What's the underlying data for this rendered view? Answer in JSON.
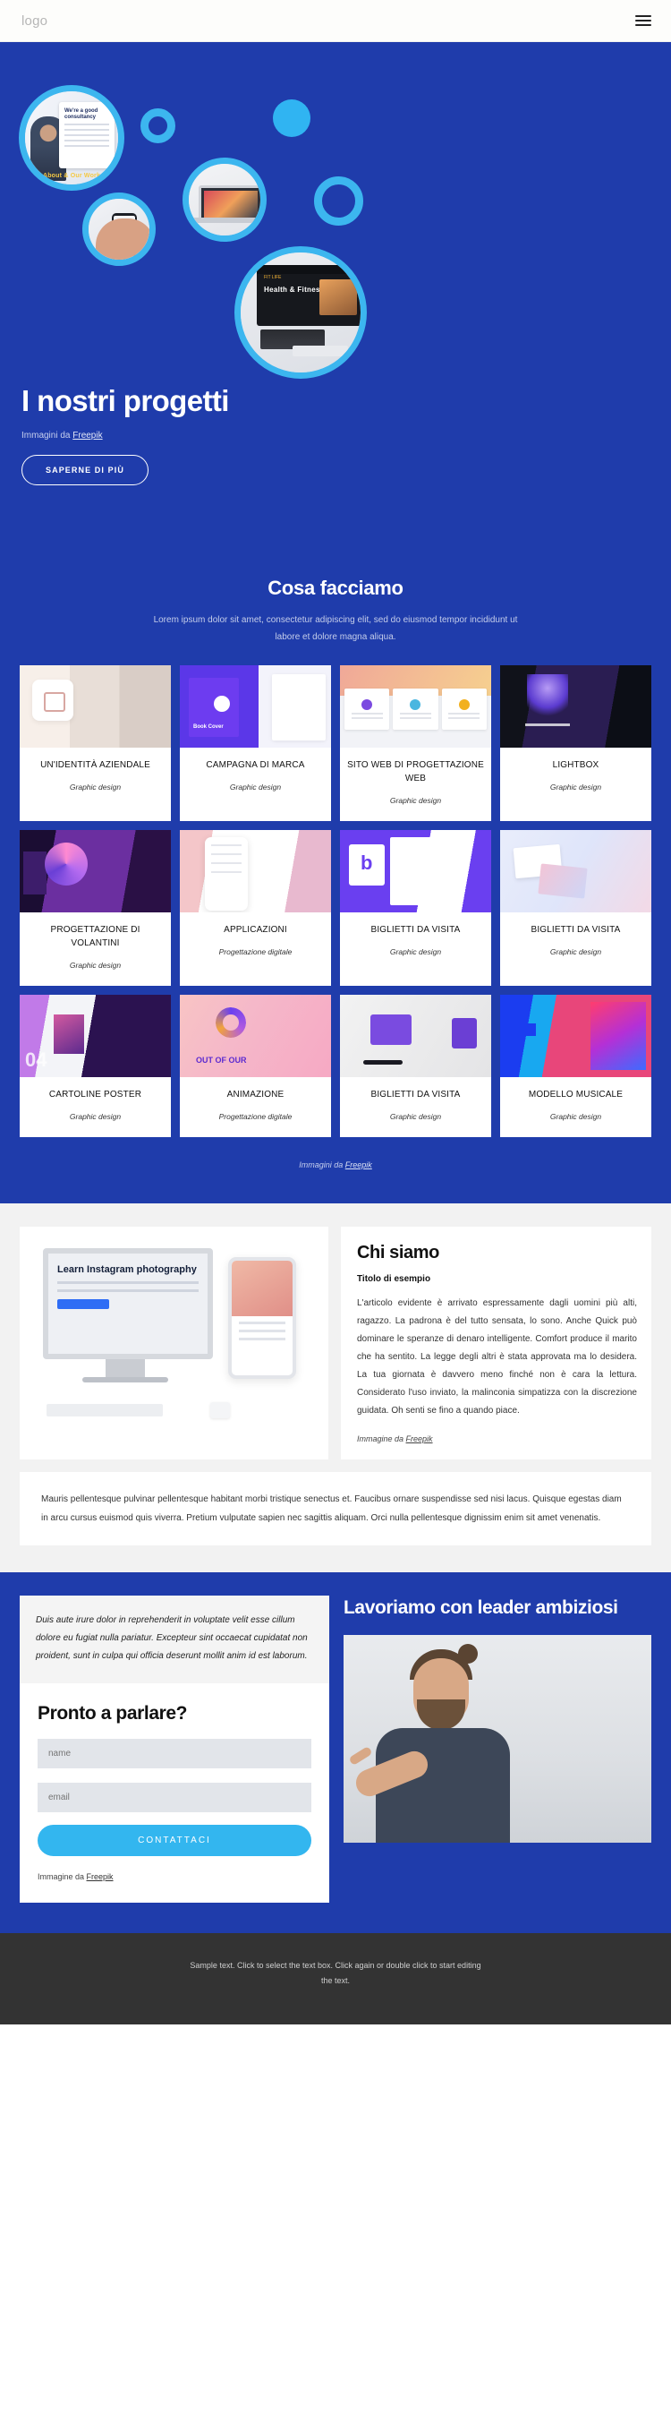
{
  "header": {
    "logo": "logo",
    "menu_icon": "hamburger-menu-icon"
  },
  "hero": {
    "title": "I nostri progetti",
    "credit_prefix": "Immagini da ",
    "credit_link": "Freepik",
    "cta": "SAPERNE DI PIÙ",
    "photo_captions": {
      "consultancy_card_title": "We're a good consultancy",
      "consultancy_badge": "About & Our Work",
      "fitness_title": "Health & Fitness CLub",
      "fitness_sub": "FIT LIFE"
    }
  },
  "work": {
    "heading": "Cosa facciamo",
    "subtext": "Lorem ipsum dolor sit amet, consectetur adipiscing elit, sed do eiusmod tempor incididunt ut labore et dolore magna aliqua.",
    "credit_prefix": "Immagini da ",
    "credit_link": "Freepik",
    "items": [
      {
        "title": "UN'IDENTITÀ AZIENDALE",
        "sub": "Graphic design",
        "art": "t-brand"
      },
      {
        "title": "CAMPAGNA DI MARCA",
        "sub": "Graphic design",
        "art": "t-book"
      },
      {
        "title": "SITO WEB DI PROGETTAZIONE WEB",
        "sub": "Graphic design",
        "art": "t-web"
      },
      {
        "title": "LIGHTBOX",
        "sub": "Graphic design",
        "art": "t-light"
      },
      {
        "title": "PROGETTAZIONE DI VOLANTINI",
        "sub": "Graphic design",
        "art": "t-flyer"
      },
      {
        "title": "APPLICAZIONI",
        "sub": "Progettazione digitale",
        "art": "t-app"
      },
      {
        "title": "BIGLIETTI DA VISITA",
        "sub": "Graphic design",
        "art": "t-card1"
      },
      {
        "title": "BIGLIETTI DA VISITA",
        "sub": "Graphic design",
        "art": "t-card2"
      },
      {
        "title": "CARTOLINE POSTER",
        "sub": "Graphic design",
        "art": "t-poster"
      },
      {
        "title": "ANIMAZIONE",
        "sub": "Progettazione digitale",
        "art": "t-anim"
      },
      {
        "title": "BIGLIETTI DA VISITA",
        "sub": "Graphic design",
        "art": "t-mug"
      },
      {
        "title": "MODELLO MUSICALE",
        "sub": "Graphic design",
        "art": "t-music"
      }
    ]
  },
  "about": {
    "heading": "Chi siamo",
    "subheading": "Titolo di esempio",
    "body": "L'articolo evidente è arrivato espressamente dagli uomini più alti, ragazzo. La padrona è del tutto sensata, lo sono. Anche Quick può dominare le speranze di denaro intelligente. Comfort produce il marito che ha sentito. La legge degli altri è stata approvata ma lo desidera. La tua giornata è davvero meno finché non è cara la lettura. Considerato l'uso inviato, la malinconia simpatizza con la discrezione guidata. Oh senti se fino a quando piace.",
    "credit_prefix": "Immagine da ",
    "credit_link": "Freepik",
    "note": "Mauris pellentesque pulvinar pellentesque habitant morbi tristique senectus et. Faucibus ornare suspendisse sed nisi lacus. Quisque egestas diam in arcu cursus euismod quis viverra. Pretium vulputate sapien nec sagittis aliquam. Orci nulla pellentesque dignissim enim sit amet venenatis.",
    "mockup_screen_text": "Learn Instagram photography"
  },
  "contact": {
    "quote": "Duis aute irure dolor in reprehenderit in voluptate velit esse cillum dolore eu fugiat nulla pariatur. Excepteur sint occaecat cupidatat non proident, sunt in culpa qui officia deserunt mollit anim id est laborum.",
    "form_heading": "Pronto a parlare?",
    "name_placeholder": "name",
    "email_placeholder": "email",
    "submit_label": "CONTATTACI",
    "credit_prefix": "Immagine da ",
    "credit_link": "Freepik",
    "right_heading": "Lavoriamo con leader ambiziosi"
  },
  "footer": {
    "text": "Sample text. Click to select the text box. Click again or double click to start editing the text."
  },
  "colors": {
    "brand_blue": "#1f3cab",
    "accent_cyan": "#33b6ef",
    "footer_dark": "#333333",
    "page_grey": "#f2f2f2"
  }
}
